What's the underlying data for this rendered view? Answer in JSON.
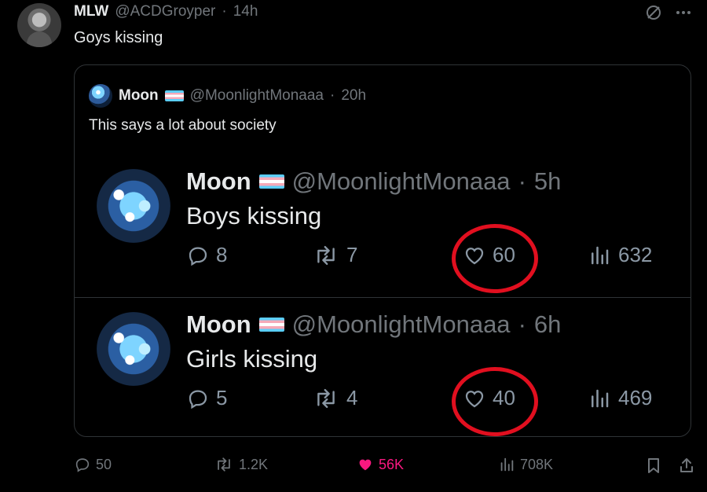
{
  "post": {
    "author_name": "MLW",
    "author_handle": "@ACDGroyper",
    "separator": "·",
    "time": "14h",
    "text": "Goys kissing"
  },
  "quote": {
    "author_name": "Moon",
    "author_handle": "@MoonlightMonaaa",
    "separator": "·",
    "time": "20h",
    "text": "This says a lot about society",
    "embedded": [
      {
        "author_name": "Moon",
        "author_handle": "@MoonlightMonaaa",
        "separator": "·",
        "time": "5h",
        "text": "Boys kissing",
        "replies": "8",
        "retweets": "7",
        "likes": "60",
        "views": "632"
      },
      {
        "author_name": "Moon",
        "author_handle": "@MoonlightMonaaa",
        "separator": "·",
        "time": "6h",
        "text": "Girls kissing",
        "replies": "5",
        "retweets": "4",
        "likes": "40",
        "views": "469"
      }
    ]
  },
  "actions": {
    "replies": "50",
    "retweets": "1.2K",
    "likes": "56K",
    "views": "708K"
  },
  "colors": {
    "background": "#000000",
    "text": "#e7e9ea",
    "muted": "#71767b",
    "border": "#2f3336",
    "like": "#f91880",
    "annotation": "#e10f1f"
  },
  "icons": [
    "grok-icon",
    "more-icon",
    "reply-icon",
    "retweet-icon",
    "heart-icon",
    "views-icon",
    "bookmark-icon",
    "share-icon",
    "trans-flag-icon"
  ]
}
